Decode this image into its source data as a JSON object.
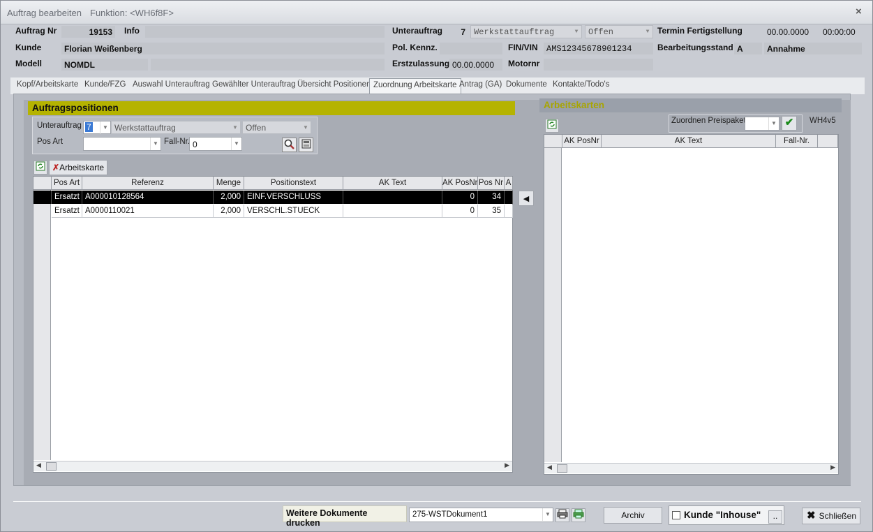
{
  "window": {
    "title": "Auftrag bearbeiten",
    "function": "Funktion: <WH6f8F>",
    "close": "×"
  },
  "header": {
    "auftrag_nr_label": "Auftrag Nr",
    "auftrag_nr": "19153",
    "info_label": "Info",
    "info": "",
    "unterauftrag_label": "Unterauftrag",
    "unterauftrag_nr": "7",
    "unterauftrag_type": "Werkstattauftrag",
    "unterauftrag_status": "Offen",
    "termin_label": "Termin Fertigstellung",
    "termin_date": "00.00.0000",
    "termin_time": "00:00:00",
    "kunde_label": "Kunde",
    "kunde": "Florian Weißenberg",
    "pol_label": "Pol. Kennz.",
    "pol": "",
    "fin_label": "FIN/VIN",
    "fin": "AMS12345678901234",
    "bearb_label": "Bearbeitungsstand",
    "bearb_code": "A",
    "bearb_text": "Annahme",
    "modell_label": "Modell",
    "modell": "NOMDL",
    "erstzul_label": "Erstzulassung",
    "erstzul": "00.00.0000",
    "motor_label": "Motornr",
    "motor": ""
  },
  "tabs": [
    "Kopf/Arbeitskarte",
    "Kunde/FZG",
    "Auswahl Unterauftrag",
    "Gewählter Unterauftrag",
    "Übersicht Positionen",
    "Zuordnung Arbeitskarte",
    "Antrag (GA)",
    "Dokumente",
    "Kontakte/Todo's"
  ],
  "left_panel": {
    "title": "Auftragspositionen",
    "unterauftrag_label": "Unterauftrag",
    "unterauftrag_value": "7",
    "type_value": "Werkstattauftrag",
    "status_value": "Offen",
    "posart_label": "Pos Art",
    "posart_value": "",
    "fallnr_label": "Fall-Nr.",
    "fallnr_value": "0",
    "arbeitskarte_button": "Arbeitskarte",
    "columns": [
      "Pos Art",
      "Referenz",
      "Menge",
      "Positionstext",
      "AK Text",
      "AK PosNr",
      "Pos Nr",
      "A"
    ],
    "rows": [
      [
        "Ersatzt",
        "A000010128564",
        "2,000",
        "EINF.VERSCHLUSS",
        "",
        "0",
        "34",
        ""
      ],
      [
        "Ersatzt",
        "A0000110021",
        "2,000",
        "VERSCHL.STUECK",
        "",
        "0",
        "35",
        ""
      ]
    ]
  },
  "right_panel": {
    "title": "Arbeitskarten",
    "preispaket_label": "Zuordnen Preispaket",
    "preispaket_value": "",
    "code": "WH4v5",
    "columns": [
      "AK PosNr",
      "AK Text",
      "Fall-Nr."
    ]
  },
  "footer": {
    "weitere_label": "Weitere Dokumente drucken",
    "dokument_value": "275-WSTDokument1",
    "archiv": "Archiv",
    "inhouse_label": "Kunde \"Inhouse\"",
    "more": "..",
    "schliessen": "Schließen"
  }
}
